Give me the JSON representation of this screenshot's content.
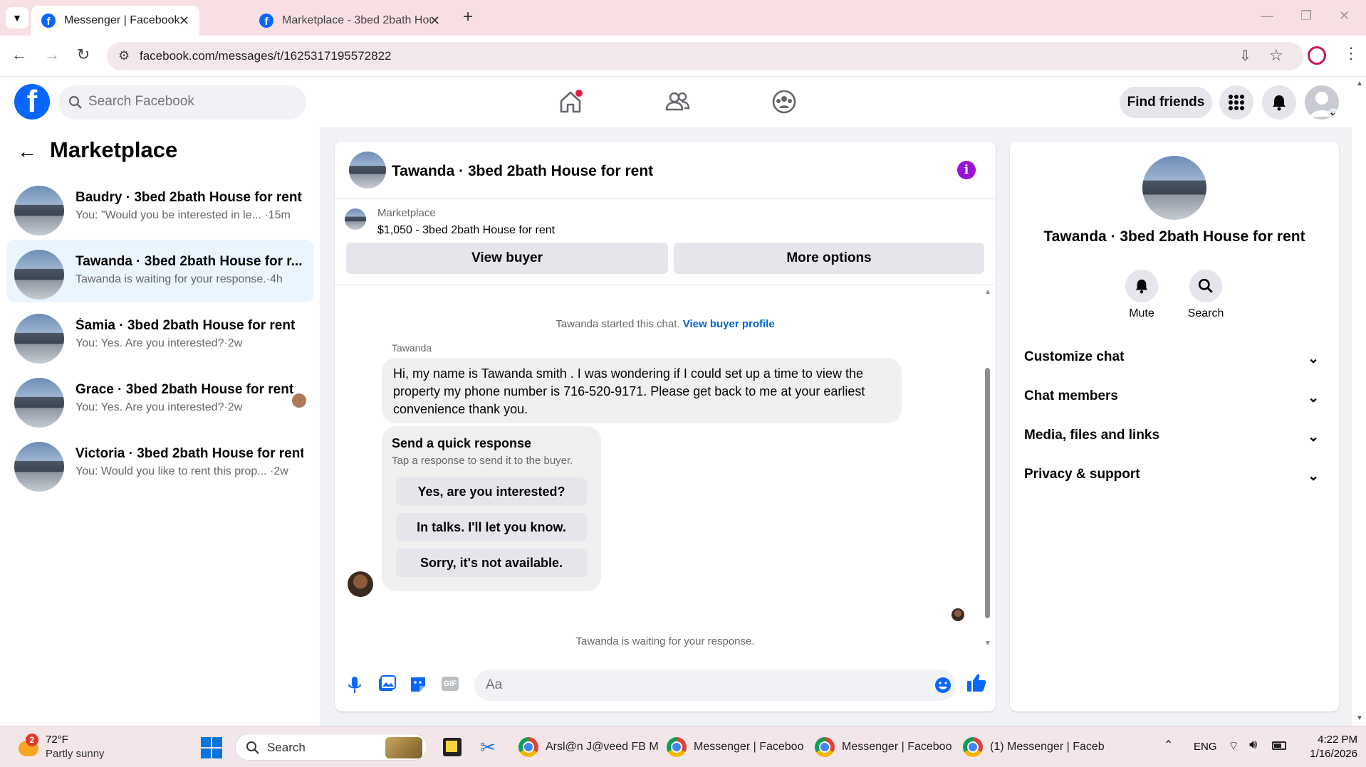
{
  "browser": {
    "tabs": [
      {
        "title": "Messenger | Facebook",
        "active": true
      },
      {
        "title": "Marketplace - 3bed 2bath Hou",
        "active": false
      }
    ],
    "url": "facebook.com/messages/t/1625317195572822"
  },
  "fb_header": {
    "search_placeholder": "Search Facebook",
    "find_friends": "Find friends",
    "brand_color": "#0866ff"
  },
  "sidebar": {
    "title": "Marketplace",
    "conversations": [
      {
        "name": "Baudry · 3bed 2bath House for rent",
        "preview": "You: \"Would you be interested in le...",
        "time": "·15m",
        "selected": false
      },
      {
        "name": "Tawanda · 3bed 2bath House for r...",
        "preview": "Tawanda is waiting for your response.",
        "time": "·4h",
        "selected": true
      },
      {
        "name": "Śamia · 3bed 2bath House for rent",
        "preview": "You: Yes. Are you interested?",
        "time": "·2w",
        "selected": false
      },
      {
        "name": "Grace · 3bed 2bath House for rent",
        "preview": "You: Yes. Are you interested?",
        "time": "·2w",
        "selected": false
      },
      {
        "name": "Victoria · 3bed 2bath House for rent",
        "preview": "You: Would you like to rent this prop...",
        "time": "·2w",
        "selected": false
      }
    ]
  },
  "chat": {
    "title": "Tawanda · 3bed 2bath House for rent",
    "listing": {
      "label": "Marketplace",
      "price_title": "$1,050 - 3bed 2bath House for rent",
      "view_buyer": "View buyer",
      "more_options": "More options"
    },
    "started_text": "Tawanda started this chat.",
    "view_buyer_profile": "View buyer profile",
    "sender": "Tawanda",
    "message": "Hi, my name is Tawanda smith . I was wondering if I could set up a time to view the property my phone number is 716-520-9171. Please get back to me at your earliest convenience thank you.",
    "quick_response": {
      "title": "Send a quick response",
      "subtitle": "Tap a response to send it to the buyer.",
      "options": [
        "Yes, are you interested?",
        "In talks. I'll let you know.",
        "Sorry, it's not available."
      ]
    },
    "waiting_text": "Tawanda is waiting for your response.",
    "input_placeholder": "Aa",
    "gif_label": "GIF"
  },
  "details": {
    "title": "Tawanda · 3bed 2bath House for rent",
    "mute": "Mute",
    "search": "Search",
    "sections": [
      "Customize chat",
      "Chat members",
      "Media, files and links",
      "Privacy & support"
    ]
  },
  "taskbar": {
    "weather_temp": "72°F",
    "weather_desc": "Partly sunny",
    "weather_badge": "2",
    "search": "Search",
    "apps": [
      "Arsl@n J@veed FB M",
      "Messenger | Faceboo",
      "Messenger | Faceboo",
      "(1) Messenger | Faceb"
    ],
    "lang": "ENG",
    "time": "4:22 PM",
    "date": "1/16/2026"
  }
}
